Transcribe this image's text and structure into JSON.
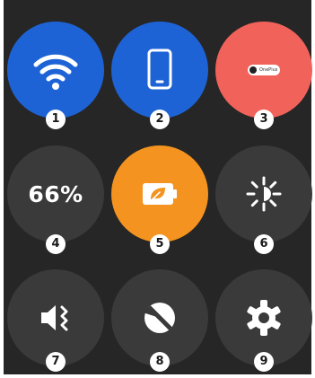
{
  "colors": {
    "panel_background": "#262626",
    "tile_active_blue": "#1e63d5",
    "tile_coral": "#f1625b",
    "tile_orange": "#f4931f",
    "tile_inactive": "#3a3a3a",
    "icon": "#ffffff"
  },
  "tiles": [
    {
      "badge": "1",
      "icon": "wifi-icon",
      "state": "on"
    },
    {
      "badge": "2",
      "icon": "phone-icon",
      "state": "on"
    },
    {
      "badge": "3",
      "icon": "earbuds-connect-icon",
      "label": "OnePlus",
      "state": "on"
    },
    {
      "badge": "4",
      "label": "66%",
      "state": "off"
    },
    {
      "badge": "5",
      "icon": "battery-saver-icon",
      "state": "on"
    },
    {
      "badge": "6",
      "icon": "brightness-icon",
      "state": "off"
    },
    {
      "badge": "7",
      "icon": "vibrate-mute-icon",
      "state": "off"
    },
    {
      "badge": "8",
      "icon": "do-not-disturb-icon",
      "state": "off"
    },
    {
      "badge": "9",
      "icon": "settings-gear-icon",
      "state": "off"
    }
  ]
}
